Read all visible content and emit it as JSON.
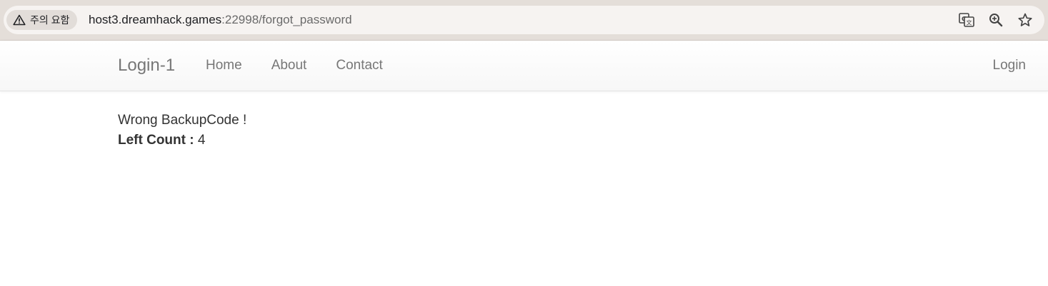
{
  "browser": {
    "security_chip_label": "주의 요함",
    "url_host": "host3.dreamhack.games",
    "url_rest": ":22998/forgot_password",
    "icons": [
      "warning-icon",
      "translate-icon",
      "zoom-icon",
      "bookmark-star-icon"
    ]
  },
  "navbar": {
    "brand": "Login-1",
    "links": [
      "Home",
      "About",
      "Contact"
    ],
    "right_link": "Login"
  },
  "main": {
    "message": "Wrong BackupCode !",
    "left_count_label": "Left Count :",
    "left_count_value": "4"
  },
  "colors": {
    "chrome_bg": "#e4ded9",
    "omnibox_bg": "#f6f3f1",
    "nav_text": "#777777",
    "body_text": "#333333"
  }
}
